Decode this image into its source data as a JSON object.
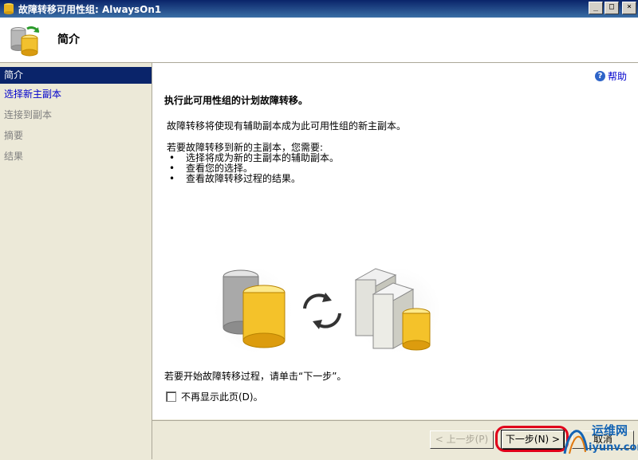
{
  "window": {
    "title": "故障转移可用性组: AlwaysOn1",
    "minimize_label": "_",
    "maximize_label": "□",
    "close_label": "×"
  },
  "header": {
    "title": "简介"
  },
  "nav": {
    "items": [
      {
        "label": "简介",
        "state": "selected"
      },
      {
        "label": "选择新主副本",
        "state": "link"
      },
      {
        "label": "连接到副本",
        "state": "disabled"
      },
      {
        "label": "摘要",
        "state": "disabled"
      },
      {
        "label": "结果",
        "state": "disabled"
      }
    ]
  },
  "content": {
    "help_label": "帮助",
    "help_icon_glyph": "?",
    "heading": "执行此可用性组的计划故障转移。",
    "description": "故障转移将使现有辅助副本成为此可用性组的新主副本。",
    "need_intro": "若要故障转移到新的主副本，您需要:",
    "bullets": [
      "选择将成为新的主副本的辅助副本。",
      "查看您的选择。",
      "查看故障转移过程的结果。"
    ],
    "start_text": "若要开始故障转移过程，请单击“下一步”。",
    "dont_show_label": "不再显示此页(D)。"
  },
  "footer": {
    "prev_label": "< 上一步(P)",
    "next_label": "下一步(N) >",
    "cancel_label": "取消"
  },
  "watermark": {
    "brand": "运维网",
    "url": "iyunv.com"
  },
  "colors": {
    "nav_selected": "#0a246a",
    "link": "#0000cc",
    "highlight": "#e0001a"
  }
}
